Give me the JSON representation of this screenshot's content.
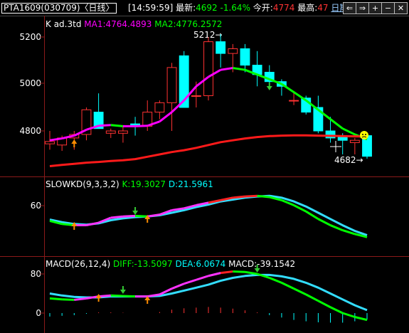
{
  "header": {
    "symbol": "PTA1609(030709)〈日线〉",
    "time": "[14:59:59]",
    "latest_label": "最新:",
    "latest_value": "4692",
    "change": "-1.64%",
    "open_label": "今开:",
    "open_value": "4774",
    "high_label": "最高:",
    "high_value": "47",
    "period_link": "日期",
    "colors": {
      "up": "#ff3232",
      "down": "#00ff00",
      "accent": "#ffff00",
      "cyan": "#00ffff"
    }
  },
  "window_controls": [
    {
      "icon": "scroll-left-icon",
      "glyph": "⇐"
    },
    {
      "icon": "scroll-right-icon",
      "glyph": "⇒"
    },
    {
      "icon": "zoom-in-icon",
      "glyph": "+"
    },
    {
      "icon": "zoom-out-icon",
      "glyph": "−"
    },
    {
      "icon": "close-icon",
      "glyph": "✕"
    }
  ],
  "kline_panel": {
    "title": "K",
    "period": "ad.3td",
    "ma1": "MA1:4764.4893",
    "ma2": "MA2:4776.2572",
    "y_ticks": [
      "5200",
      "5000",
      "4800"
    ],
    "peak_label": "5212",
    "low_label": "4682"
  },
  "kd_panel": {
    "title": "SLOWKD(9,3,3,2)",
    "k": "K:19.3027",
    "d": "D:21.5961",
    "y_ticks": [
      "60"
    ]
  },
  "macd_panel": {
    "title": "MACD(26,12,4)",
    "diff": "DIFF:-13.5097",
    "dea": "DEA:6.0674",
    "macd": "MACD:-39.1542",
    "y_ticks": [
      "80",
      "0"
    ]
  },
  "chart_data": {
    "type": "candlestick",
    "price_ylim": [
      4660,
      5290
    ],
    "candles": [
      {
        "o": 4745,
        "h": 4800,
        "l": 4720,
        "c": 4755
      },
      {
        "o": 4740,
        "h": 4780,
        "l": 4715,
        "c": 4770
      },
      {
        "o": 4770,
        "h": 4800,
        "l": 4720,
        "c": 4785
      },
      {
        "o": 4785,
        "h": 4900,
        "l": 4760,
        "c": 4890
      },
      {
        "o": 4880,
        "h": 4960,
        "l": 4820,
        "c": 4810
      },
      {
        "o": 4790,
        "h": 4810,
        "l": 4770,
        "c": 4800
      },
      {
        "o": 4790,
        "h": 4820,
        "l": 4750,
        "c": 4800
      },
      {
        "o": 4830,
        "h": 4860,
        "l": 4780,
        "c": 4820
      },
      {
        "o": 4820,
        "h": 4930,
        "l": 4800,
        "c": 4880
      },
      {
        "o": 4880,
        "h": 4930,
        "l": 4850,
        "c": 4920
      },
      {
        "o": 4920,
        "h": 5090,
        "l": 4800,
        "c": 5070
      },
      {
        "o": 5120,
        "h": 5140,
        "l": 4900,
        "c": 4900
      },
      {
        "o": 4950,
        "h": 5010,
        "l": 4900,
        "c": 4950
      },
      {
        "o": 4950,
        "h": 5200,
        "l": 4930,
        "c": 5180
      },
      {
        "o": 5180,
        "h": 5212,
        "l": 5070,
        "c": 5130
      },
      {
        "o": 5130,
        "h": 5170,
        "l": 5050,
        "c": 5150
      },
      {
        "o": 5150,
        "h": 5170,
        "l": 5050,
        "c": 5080
      },
      {
        "o": 5080,
        "h": 5140,
        "l": 4990,
        "c": 5040
      },
      {
        "o": 5050,
        "h": 5080,
        "l": 5000,
        "c": 5010
      },
      {
        "o": 5010,
        "h": 5020,
        "l": 4950,
        "c": 4990
      },
      {
        "o": 4930,
        "h": 4970,
        "l": 4910,
        "c": 4930
      },
      {
        "o": 4940,
        "h": 4950,
        "l": 4870,
        "c": 4880
      },
      {
        "o": 4900,
        "h": 4950,
        "l": 4790,
        "c": 4800
      },
      {
        "o": 4800,
        "h": 4860,
        "l": 4750,
        "c": 4770
      },
      {
        "o": 4780,
        "h": 4790,
        "l": 4700,
        "c": 4760
      },
      {
        "o": 4750,
        "h": 4770,
        "l": 4700,
        "c": 4760
      },
      {
        "o": 4780,
        "h": 4790,
        "l": 4682,
        "c": 4692
      }
    ],
    "ma_fast": [
      4760,
      4768,
      4780,
      4805,
      4822,
      4825,
      4820,
      4820,
      4822,
      4840,
      4880,
      4930,
      4990,
      5030,
      5060,
      5068,
      5060,
      5040,
      5020,
      5000,
      4965,
      4930,
      4890,
      4850,
      4810,
      4785,
      4764
    ],
    "ma_slow": [
      4650,
      4655,
      4660,
      4665,
      4668,
      4672,
      4675,
      4680,
      4690,
      4700,
      4710,
      4718,
      4728,
      4740,
      4752,
      4760,
      4768,
      4774,
      4778,
      4780,
      4781,
      4781,
      4780,
      4779,
      4778,
      4777,
      4776
    ],
    "kd_ylim": [
      0,
      100
    ],
    "kd_k": [
      45,
      40,
      38,
      38,
      42,
      50,
      52,
      53,
      52,
      55,
      62,
      65,
      70,
      74,
      78,
      82,
      84,
      85,
      83,
      78,
      70,
      60,
      48,
      38,
      30,
      24,
      19
    ],
    "kd_d": [
      47,
      43,
      40,
      39,
      41,
      46,
      49,
      51,
      52,
      54,
      58,
      62,
      67,
      71,
      76,
      79,
      82,
      84,
      85,
      82,
      76,
      68,
      58,
      48,
      38,
      29,
      22
    ],
    "macd_ylim": [
      -40,
      110
    ],
    "macd_diff": [
      30,
      28,
      27,
      30,
      34,
      36,
      35,
      34,
      34,
      38,
      50,
      60,
      68,
      76,
      82,
      85,
      84,
      80,
      72,
      62,
      50,
      38,
      25,
      12,
      0,
      -8,
      -14
    ],
    "macd_dea": [
      40,
      36,
      33,
      32,
      32,
      34,
      34,
      34,
      34,
      35,
      40,
      46,
      52,
      58,
      66,
      72,
      76,
      78,
      78,
      75,
      70,
      62,
      52,
      40,
      28,
      16,
      6
    ],
    "macd_hist": [
      -20,
      -16,
      -12,
      -4,
      4,
      4,
      2,
      0,
      0,
      6,
      20,
      28,
      32,
      36,
      32,
      26,
      16,
      4,
      -12,
      -26,
      -40,
      -48,
      -54,
      -56,
      -56,
      -48,
      -39
    ]
  }
}
